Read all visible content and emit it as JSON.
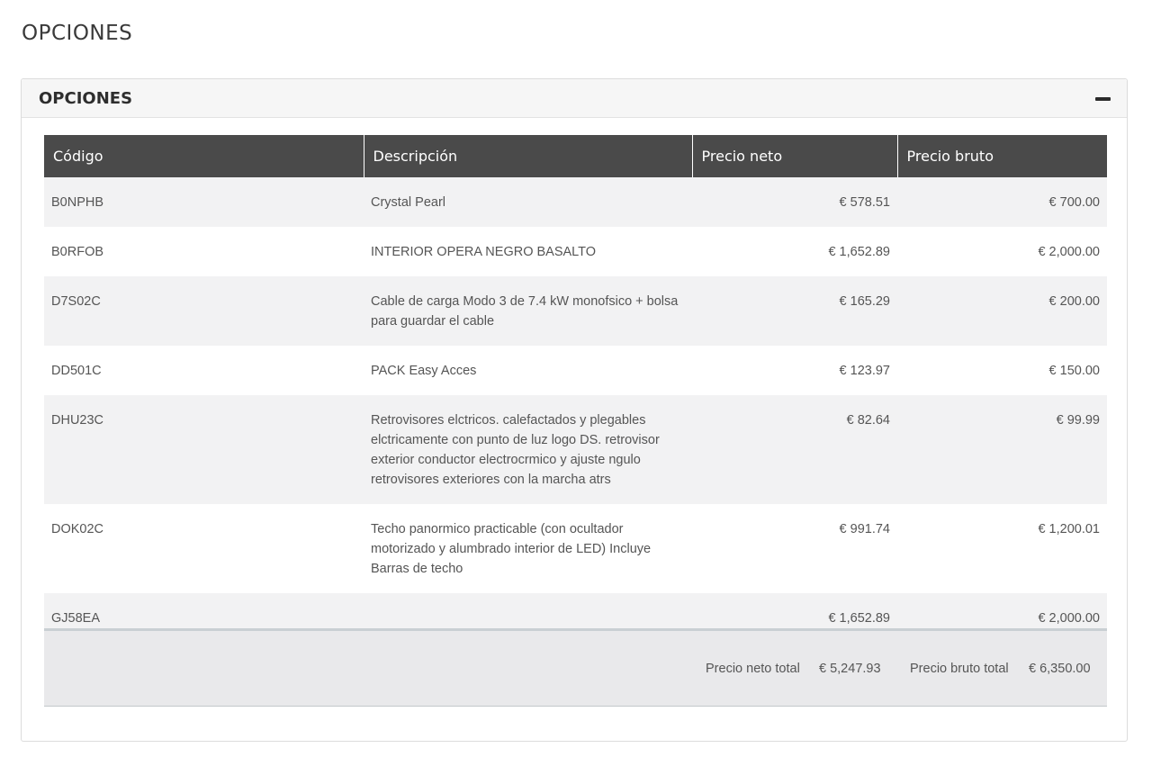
{
  "page": {
    "title": "OPCIONES"
  },
  "panel": {
    "title": "OPCIONES",
    "collapse_icon": "minus-icon"
  },
  "table": {
    "headers": [
      "Código",
      "Descripción",
      "Precio neto",
      "Precio bruto"
    ],
    "rows": [
      {
        "code": "B0NPHB",
        "description": "Crystal Pearl",
        "net": "€ 578.51",
        "gross": "€ 700.00"
      },
      {
        "code": "B0RFOB",
        "description": "INTERIOR OPERA NEGRO BASALTO",
        "net": "€ 1,652.89",
        "gross": "€ 2,000.00"
      },
      {
        "code": "D7S02C",
        "description": "Cable de carga Modo 3 de 7.4 kW monofsico + bolsa para guardar el cable",
        "net": "€ 165.29",
        "gross": "€ 200.00"
      },
      {
        "code": "DD501C",
        "description": "PACK Easy Acces",
        "net": "€ 123.97",
        "gross": "€ 150.00"
      },
      {
        "code": "DHU23C",
        "description": "Retrovisores elctricos. calefactados y plegables elctricamente con punto de luz logo DS. retrovisor exterior conductor electrocrmico y ajuste ngulo retrovisores exteriores con la marcha atrs",
        "net": "€ 82.64",
        "gross": "€ 99.99"
      },
      {
        "code": "DOK02C",
        "description": "Techo panormico practicable (con ocultador motorizado y alumbrado interior de LED) Incluye Barras de techo",
        "net": "€ 991.74",
        "gross": "€ 1,200.01"
      },
      {
        "code": "GJ58EA",
        "description": "",
        "net": "€ 1,652.89",
        "gross": "€ 2,000.00"
      }
    ]
  },
  "totals": {
    "net_label": "Precio neto total",
    "net_value": "€ 5,247.93",
    "gross_label": "Precio bruto total",
    "gross_value": "€ 6,350.00"
  }
}
